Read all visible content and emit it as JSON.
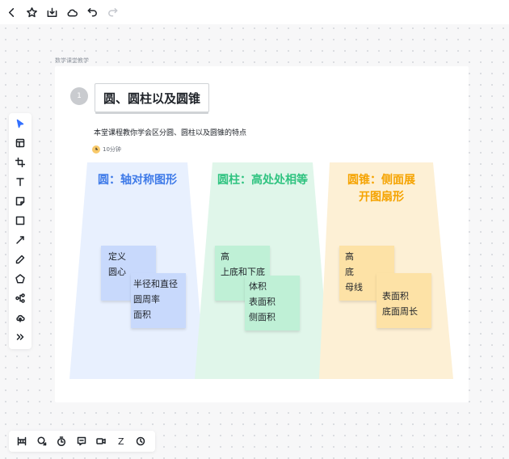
{
  "board": {
    "label": "数学课堂教学",
    "step_number": "1",
    "title": "圆、圆柱以及圆锥",
    "subtitle": "本堂课程教你学会区分圆、圆柱以及圆锥的特点",
    "duration": "10分钟"
  },
  "columns": [
    {
      "title_lines": [
        "圆：轴对称图形"
      ],
      "color": "#3e7ae8",
      "notes": [
        {
          "lines": [
            "定义",
            "圆心"
          ]
        },
        {
          "lines": [
            "半径和直径",
            "圆周率",
            "面积"
          ]
        }
      ]
    },
    {
      "title_lines": [
        "圆柱：高处处相等"
      ],
      "color": "#2fc380",
      "notes": [
        {
          "lines": [
            "高",
            "上底和下底"
          ]
        },
        {
          "lines": [
            "体积",
            "表面积",
            "侧面积"
          ]
        }
      ]
    },
    {
      "title_lines": [
        "圆锥：侧面展",
        "开图扇形"
      ],
      "color": "#f5a300",
      "notes": [
        {
          "lines": [
            "高",
            "底",
            "母线"
          ]
        },
        {
          "lines": [
            "表面积",
            "底面周长"
          ]
        }
      ]
    }
  ],
  "top_toolbar": [
    "back-icon",
    "star-icon",
    "download-icon",
    "cloud-icon",
    "undo-icon",
    "redo-icon"
  ],
  "left_toolbar": [
    "select-icon",
    "frame-icon",
    "crop-icon",
    "text-icon",
    "sticky-note-icon",
    "rectangle-icon",
    "line-icon",
    "pen-icon",
    "shape-icon",
    "mindmap-icon",
    "upload-icon",
    "more-icon"
  ],
  "bottom_toolbar": {
    "icons": [
      "minimap-icon",
      "comment-icon",
      "timer-icon",
      "chat-icon",
      "video-icon",
      "z-order-icon",
      "zoom-icon"
    ],
    "z_label": "Z"
  }
}
